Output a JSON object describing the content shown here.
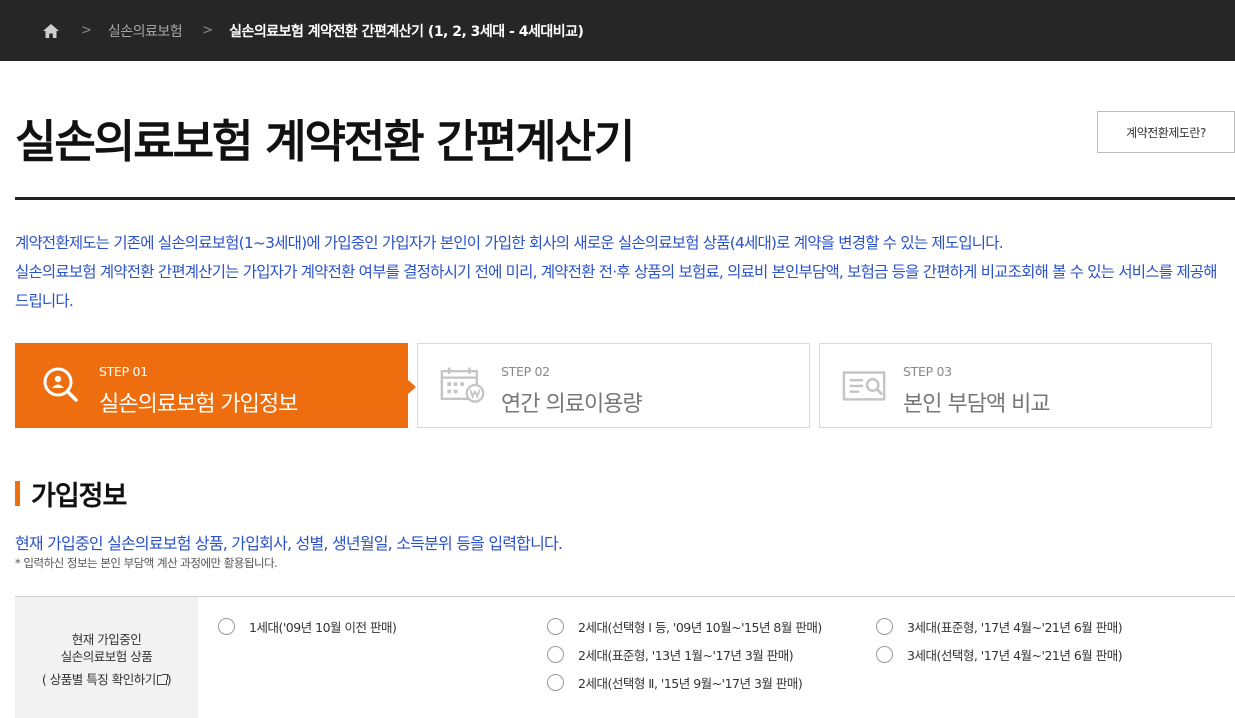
{
  "breadcrumb": {
    "items": [
      "실손의료보험",
      "실손의료보험 계약전환 간편계산기 (1, 2, 3세대 - 4세대비교)"
    ],
    "separator": ">",
    "home_icon": "home-icon"
  },
  "header": {
    "title": "실손의료보험 계약전환 간편계산기",
    "info_button": "계약전환제도란?"
  },
  "intro": {
    "line1": "계약전환제도는 기존에 실손의료보험(1~3세대)에 가입중인 가입자가 본인이 가입한 회사의 새로운 실손의료보험 상품(4세대)로 계약을 변경할 수 있는 제도입니다.",
    "line2": "실손의료보험 계약전환 간편계산기는 가입자가 계약전환 여부를 결정하시기 전에 미리, 계약전환 전·후 상품의 보험료, 의료비 본인부담액, 보험금 등을 간편하게 비교조회해 볼 수 있는 서비스를 제공해드립니다."
  },
  "steps": [
    {
      "num": "STEP 01",
      "label": "실손의료보험 가입정보",
      "active": true,
      "icon": "search-person-icon"
    },
    {
      "num": "STEP 02",
      "label": "연간 의료이용량",
      "active": false,
      "icon": "calendar-won-icon"
    },
    {
      "num": "STEP 03",
      "label": "본인 부담액 비교",
      "active": false,
      "icon": "document-search-icon"
    }
  ],
  "section": {
    "title": "가입정보",
    "description": "현재 가입중인 실손의료보험 상품, 가입회사, 성별, 생년월일, 소득분위 등을 입력합니다.",
    "note": "* 입력하신 정보는 본인 부담액 계산 과정에만 활용됩니다."
  },
  "form": {
    "product_label_line1": "현재 가입중인",
    "product_label_line2": "실손의료보험 상품",
    "product_link": "( 상품별 특징 확인하기",
    "product_link_close": ")",
    "options": [
      "1세대('09년 10월 이전 판매)",
      "2세대(선택형 Ⅰ 등, '09년 10월~'15년 8월 판매)",
      "2세대(표준형, '13년 1월~'17년 3월 판매)",
      "2세대(선택형 Ⅱ, '15년 9월~'17년 3월 판매)",
      "3세대(표준형, '17년 4월~'21년 6월 판매)",
      "3세대(선택형, '17년 4월~'21년 6월 판매)"
    ]
  },
  "colors": {
    "accent": "#ee6d0e",
    "link_blue": "#2a52c9",
    "topbar": "#262626"
  }
}
